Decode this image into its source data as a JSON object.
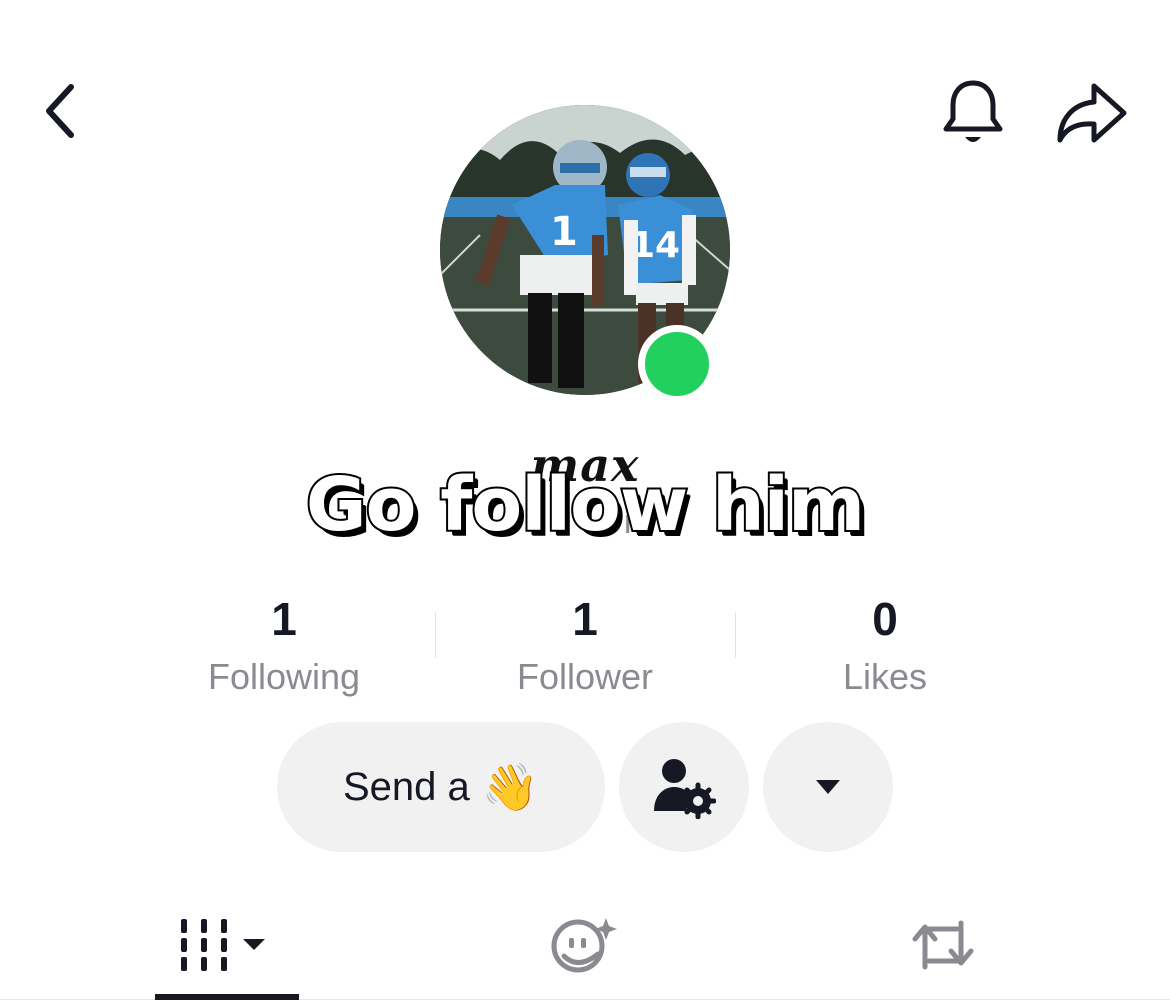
{
  "header": {
    "back_icon": "chevron-left-icon",
    "bell_icon": "bell-icon",
    "share_icon": "share-arrow-icon"
  },
  "profile": {
    "display_name": "max",
    "username_fragment": "nt",
    "online": true,
    "status_color": "#22d05d"
  },
  "overlay_caption": "Go follow him",
  "stats": [
    {
      "value": "1",
      "label": "Following"
    },
    {
      "value": "1",
      "label": "Follower"
    },
    {
      "value": "0",
      "label": "Likes"
    }
  ],
  "actions": {
    "send_label": "Send a",
    "send_emoji": "👋",
    "manage_icon": "user-gear-icon",
    "more_icon": "caret-down-icon"
  },
  "tabs": [
    {
      "name": "videos",
      "icon": "grid-columns-icon",
      "active": true
    },
    {
      "name": "favorites",
      "icon": "face-sparkle-icon",
      "active": false
    },
    {
      "name": "reposts",
      "icon": "repost-icon",
      "active": false
    }
  ]
}
